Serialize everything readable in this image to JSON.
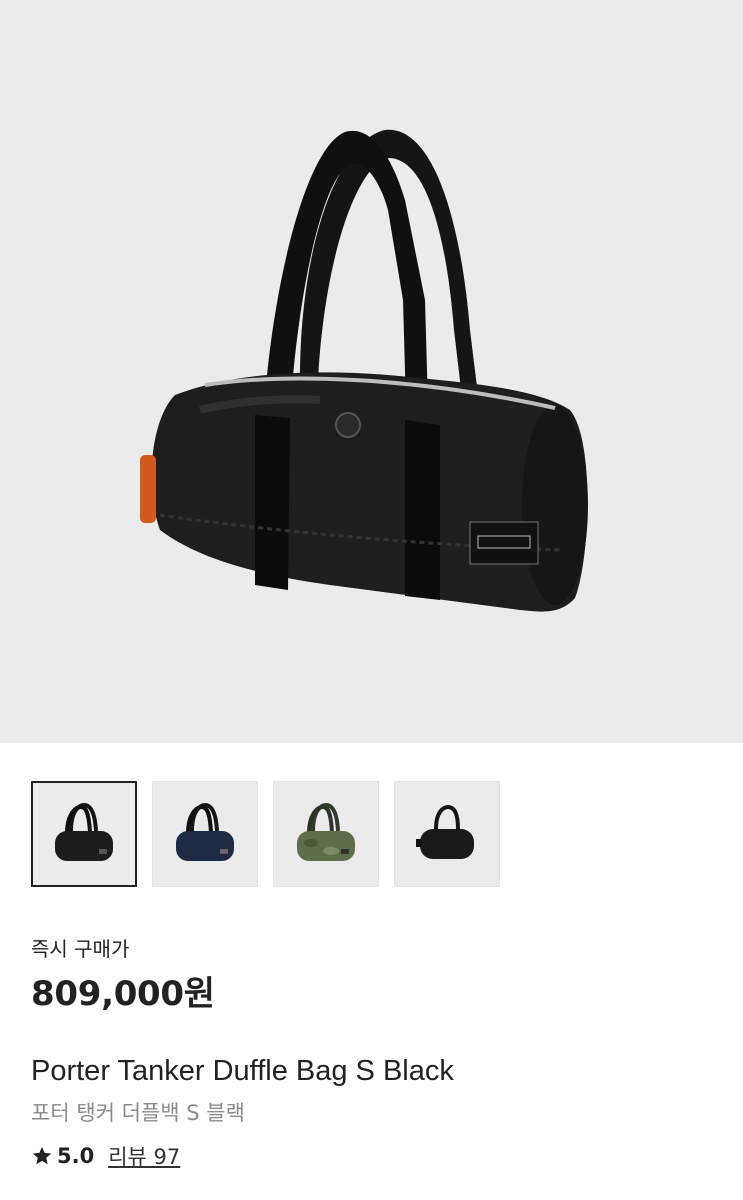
{
  "gallery": {
    "main_image": "porter-tanker-duffle-bag-black",
    "thumbnails": [
      {
        "name": "black",
        "color": "#1c1c1c",
        "selected": true
      },
      {
        "name": "navy",
        "color": "#1f2a44",
        "selected": false
      },
      {
        "name": "camo",
        "color": "#5d6f4a",
        "selected": false
      },
      {
        "name": "black-2way",
        "color": "#1a1a1a",
        "selected": false
      }
    ]
  },
  "product": {
    "price_label": "즉시 구매가",
    "price": "809,000원",
    "name_en": "Porter Tanker Duffle Bag S Black",
    "name_ko": "포터 탱커 더플백 S 블랙",
    "rating": "5.0",
    "review_text": "리뷰 97"
  },
  "icons": {
    "star": "star-icon"
  }
}
